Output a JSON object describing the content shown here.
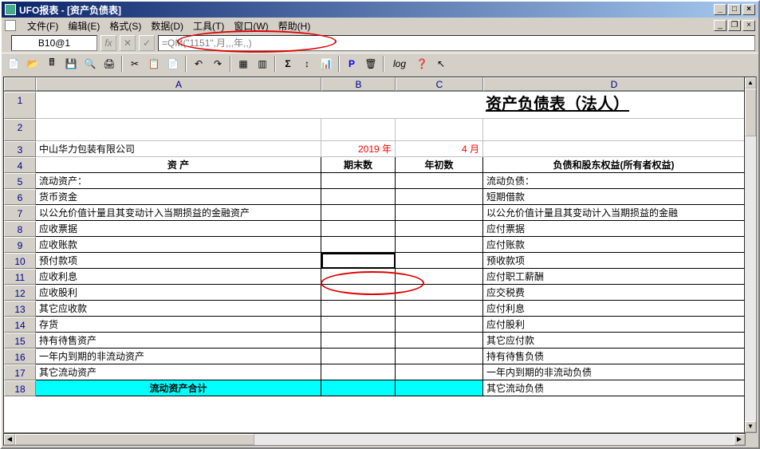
{
  "window": {
    "title": "UFO报表 - [资产负债表]"
  },
  "menus": {
    "file": "文件(F)",
    "edit": "编辑(E)",
    "format": "格式(S)",
    "data": "数据(D)",
    "tool": "工具(T)",
    "window": "窗口(W)",
    "help": "帮助(H)"
  },
  "formulaBar": {
    "cellRef": "B10@1",
    "formula": "=QM(\"1151\",月,,,年,,)"
  },
  "columns": [
    "A",
    "B",
    "C",
    "D"
  ],
  "chart_data": {
    "type": "table",
    "title": "资产负债表（法人）",
    "company": "中山华力包装有限公司",
    "year_label": "2019 年",
    "month_label": "4 月",
    "headers": {
      "assets": "资      产",
      "end_balance": "期末数",
      "begin_balance": "年初数",
      "liabilities": "负债和股东权益(所有者权益)"
    },
    "rows": [
      {
        "num": 5,
        "a": "流动资产：",
        "d": "流动负债："
      },
      {
        "num": 6,
        "a": "    货币资金",
        "d": "    短期借款"
      },
      {
        "num": 7,
        "a": "    以公允价值计量且其变动计入当期损益的金融资产",
        "d": "    以公允价值计量且其变动计入当期损益的金融"
      },
      {
        "num": 8,
        "a": "    应收票据",
        "d": "    应付票据"
      },
      {
        "num": 9,
        "a": "    应收账款",
        "d": "    应付账款"
      },
      {
        "num": 10,
        "a": "    预付款项",
        "d": "    预收款项"
      },
      {
        "num": 11,
        "a": "    应收利息",
        "d": "    应付职工薪酬"
      },
      {
        "num": 12,
        "a": "    应收股利",
        "d": "    应交税费"
      },
      {
        "num": 13,
        "a": "    其它应收款",
        "d": "    应付利息"
      },
      {
        "num": 14,
        "a": "    存货",
        "d": "    应付股利"
      },
      {
        "num": 15,
        "a": "    持有待售资产",
        "d": "    其它应付款"
      },
      {
        "num": 16,
        "a": "    一年内到期的非流动资产",
        "d": "    持有待售负债"
      },
      {
        "num": 17,
        "a": "    其它流动资产",
        "d": "    一年内到期的非流动负债"
      },
      {
        "num": 18,
        "a": "流动资产合计",
        "d": "    其它流动负债",
        "cyan": true
      }
    ]
  }
}
